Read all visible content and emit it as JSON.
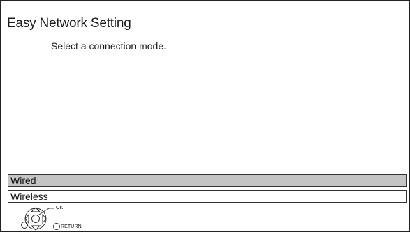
{
  "screen": {
    "title": "Easy Network Setting",
    "subtitle": "Select a connection mode."
  },
  "options": [
    {
      "label": "Wired",
      "selected": true
    },
    {
      "label": "Wireless",
      "selected": false
    }
  ],
  "guide": {
    "ok_label": "OK",
    "return_label": "RETURN",
    "icons": [
      "dpad-icon",
      "ok-button-icon",
      "return-button-icon",
      "left-button-icon"
    ]
  },
  "colors": {
    "selected_row": "#c4c4c4",
    "border": "#222222",
    "background": "#ffffff"
  }
}
